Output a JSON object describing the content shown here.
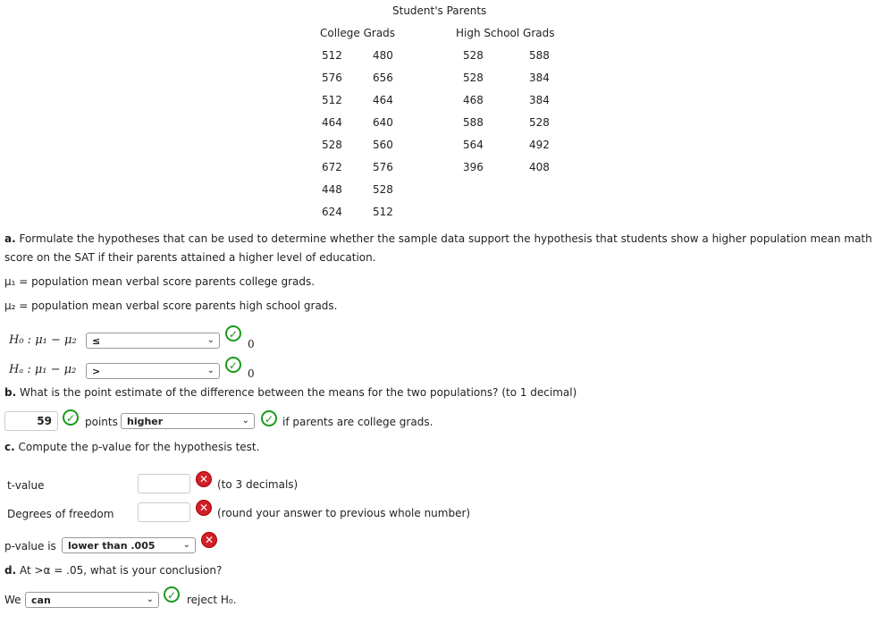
{
  "table": {
    "title": "Student's Parents",
    "col_college": "College Grads",
    "col_high": "High School Grads",
    "college": [
      [
        "512",
        "480"
      ],
      [
        "576",
        "656"
      ],
      [
        "512",
        "464"
      ],
      [
        "464",
        "640"
      ],
      [
        "528",
        "560"
      ],
      [
        "672",
        "576"
      ],
      [
        "448",
        "528"
      ],
      [
        "624",
        "512"
      ]
    ],
    "high": [
      [
        "528",
        "588"
      ],
      [
        "528",
        "384"
      ],
      [
        "468",
        "384"
      ],
      [
        "588",
        "528"
      ],
      [
        "564",
        "492"
      ],
      [
        "396",
        "408"
      ]
    ]
  },
  "part_a": {
    "label": "a.",
    "text1": "Formulate the hypotheses that can be used to determine whether the sample data support the hypothesis that students show a higher population mean math",
    "text2": "score on the SAT if their parents attained a higher level of education.",
    "mu1": "μ₁ = population mean verbal score parents college grads.",
    "mu2": "μ₂ = population mean verbal score parents high school grads.",
    "h0": "H₀ : μ₁ − μ₂",
    "h0_sel": "≤",
    "ha": "Hₐ : μ₁ − μ₂",
    "ha_sel": ">",
    "zero": "0"
  },
  "part_b": {
    "label": "b.",
    "text": "What is the point estimate of the difference between the means for the two populations? (to 1 decimal)",
    "value": "59",
    "points": "points",
    "sel": "higher",
    "suffix": "if parents are college grads."
  },
  "part_c": {
    "label": "c.",
    "text": "Compute the p-value for the hypothesis test.",
    "t_label": "t-value",
    "t_value": "",
    "t_hint": "(to 3 decimals)",
    "df_label": "Degrees of freedom",
    "df_value": "",
    "df_hint": "(round your answer to previous whole number)",
    "p_label": "p-value is",
    "p_sel": "lower than .005"
  },
  "part_d": {
    "label": "d.",
    "text": "At >α = .05, what is your conclusion?",
    "we": "We",
    "sel": "can",
    "suffix": "reject H₀."
  },
  "colors": {
    "correct": "#1a9a1a",
    "incorrect": "#d0202a"
  }
}
